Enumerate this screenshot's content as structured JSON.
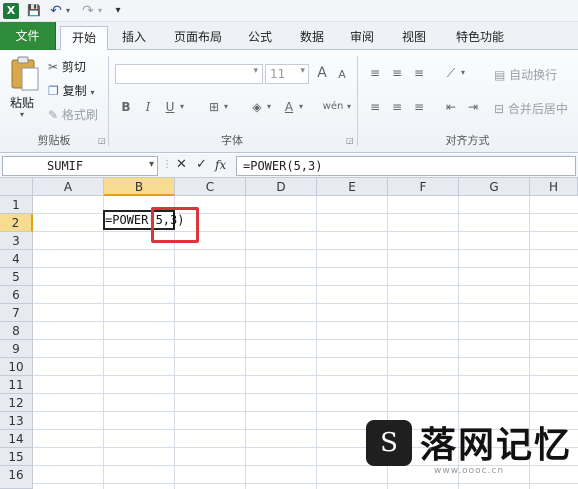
{
  "quick_access": {
    "excel_icon": "X",
    "save_icon": "💾",
    "undo_icon": "↶",
    "redo_icon": "↷",
    "customize_icon": "▾"
  },
  "tabs": [
    {
      "label": "文件"
    },
    {
      "label": "开始"
    },
    {
      "label": "插入"
    },
    {
      "label": "页面布局"
    },
    {
      "label": "公式"
    },
    {
      "label": "数据"
    },
    {
      "label": "审阅"
    },
    {
      "label": "视图"
    },
    {
      "label": "特色功能"
    }
  ],
  "ribbon": {
    "clipboard": {
      "paste_label": "粘贴",
      "cut_label": "剪切",
      "copy_label": "复制",
      "format_painter_label": "格式刷",
      "group_label": "剪贴板"
    },
    "font": {
      "font_name": "",
      "font_size": "11",
      "bold": "B",
      "italic": "I",
      "underline": "U",
      "grow": "A",
      "shrink": "A",
      "group_label": "字体"
    },
    "alignment": {
      "wrap_text_label": "自动换行",
      "merge_center_label": "合并后居中",
      "group_label": "对齐方式"
    }
  },
  "formula_bar": {
    "name_box": "SUMIF",
    "cancel": "✕",
    "enter": "✓",
    "fx": "fx",
    "formula": "=POWER(5,3)"
  },
  "sheet": {
    "columns": [
      "A",
      "B",
      "C",
      "D",
      "E",
      "F",
      "G",
      "H"
    ],
    "rows": [
      "1",
      "2",
      "3",
      "4",
      "5",
      "6",
      "7",
      "8",
      "9",
      "10",
      "11",
      "12",
      "13",
      "14",
      "15",
      "16"
    ],
    "active_cell_text": "=POWER(5,3)"
  },
  "watermark": {
    "brand": "落网记忆",
    "url": "www.oooc.cn"
  },
  "colors": {
    "file_tab": "#2e8b3a",
    "selection_header": "#f7dc8f",
    "highlight_box": "#d9353b"
  }
}
